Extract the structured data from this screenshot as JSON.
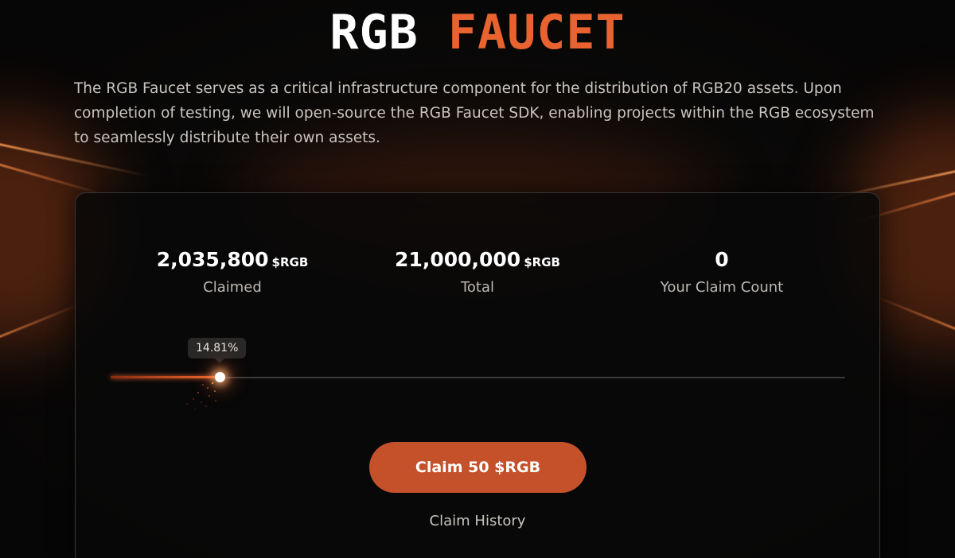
{
  "header": {
    "title_part1": "RGB",
    "title_part2": "FAUCET",
    "description": "The RGB Faucet serves as a critical infrastructure component for the distribution of RGB20 assets. Upon completion of testing, we will open-source the RGB Faucet SDK, enabling projects within the RGB ecosystem to seamlessly distribute their own assets."
  },
  "stats": {
    "claimed": {
      "value": "2,035,800",
      "unit": "$RGB",
      "label": "Claimed"
    },
    "total": {
      "value": "21,000,000",
      "unit": "$RGB",
      "label": "Total"
    },
    "claim_count": {
      "value": "0",
      "label": "Your Claim Count"
    }
  },
  "progress": {
    "label": "14.81%",
    "fraction": 0.1481
  },
  "actions": {
    "claim_label": "Claim 50 $RGB",
    "history_label": "Claim History"
  },
  "colors": {
    "accent": "#e8632f",
    "button": "#c4512a",
    "background": "#0a0908"
  }
}
